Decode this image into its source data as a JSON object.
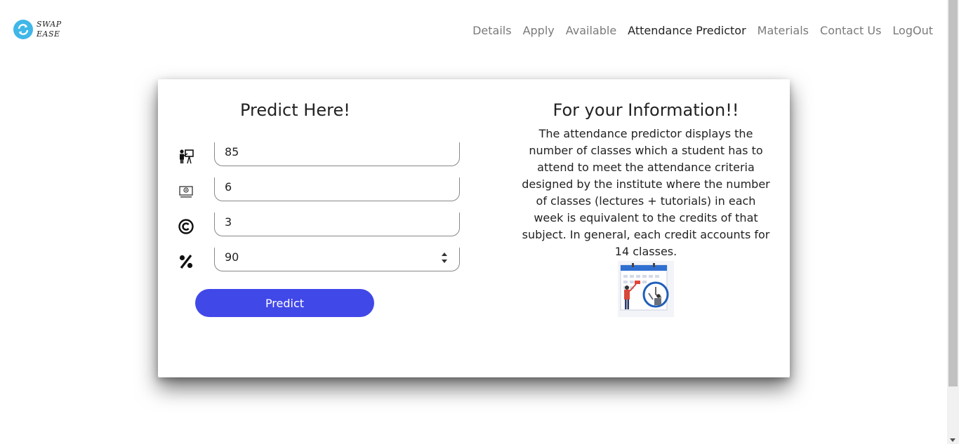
{
  "brand": {
    "line1": "SWAP",
    "line2": "EASE"
  },
  "nav": {
    "items": [
      {
        "label": "Details",
        "active": false
      },
      {
        "label": "Apply",
        "active": false
      },
      {
        "label": "Available",
        "active": false
      },
      {
        "label": "Attendance Predictor",
        "active": true
      },
      {
        "label": "Materials",
        "active": false
      },
      {
        "label": "Contact Us",
        "active": false
      },
      {
        "label": "LogOut",
        "active": false
      }
    ]
  },
  "form": {
    "title": "Predict Here!",
    "fields": [
      {
        "icon": "lecture-icon",
        "value": "85"
      },
      {
        "icon": "tutorial-icon",
        "value": "6"
      },
      {
        "icon": "credits-icon",
        "value": "3"
      },
      {
        "icon": "percent-icon",
        "value": "90"
      }
    ],
    "button_label": "Predict"
  },
  "info": {
    "title": "For your Information!!",
    "body": "The attendance predictor displays the number of classes which a student has to attend to meet the attendance criteria designed by the institute where the number of classes (lectures + tutorials) in each week is equivalent to the credits of that subject. In general, each credit accounts for 14 classes.",
    "illustration_icon": "calendar-illustration-icon"
  },
  "colors": {
    "accent": "#4148e8",
    "logo": "#3fb7e8",
    "nav_active": "#222222",
    "nav_inactive": "#7a7a7a"
  }
}
